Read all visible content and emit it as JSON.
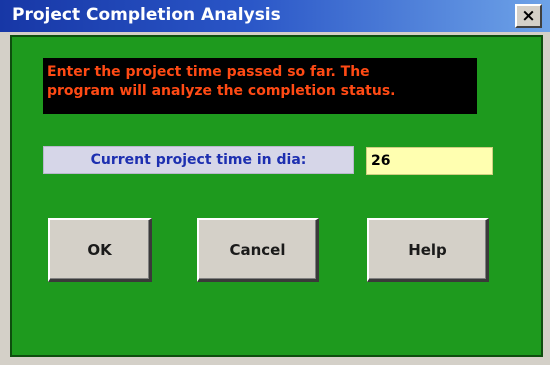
{
  "window": {
    "title": "Project Completion Analysis",
    "close_label": "×"
  },
  "prompt": {
    "line1": "Enter the project time passed so far.  The",
    "line2": "program will analyze the completion status."
  },
  "field": {
    "label": "Current project time in dia:",
    "value": "26"
  },
  "buttons": {
    "ok": "OK",
    "cancel": "Cancel",
    "help": "Help"
  },
  "colors": {
    "titlebar": "#1737a6",
    "client_background": "#1e9a1e",
    "prompt_background": "#000000",
    "prompt_text": "#ff4a14",
    "label_background": "#d6d6e8",
    "label_text": "#1d2fb0",
    "input_background": "#ffffb0"
  }
}
